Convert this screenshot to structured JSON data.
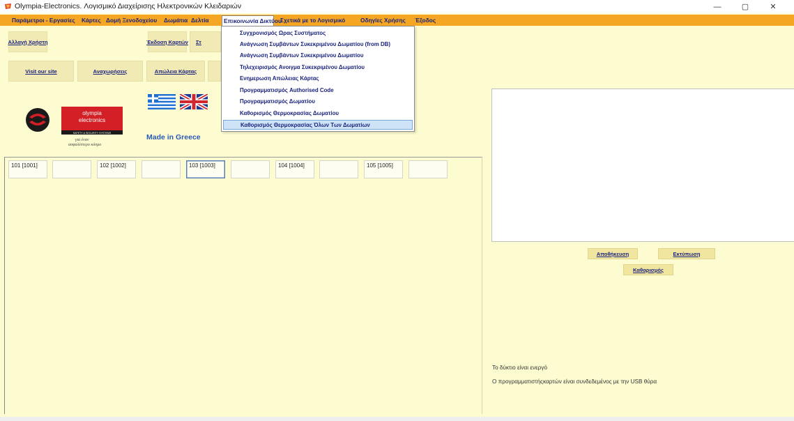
{
  "window": {
    "title": "Olympia-Electronics. Λογισμικό Διαχείρισης Ηλεκτρονικών Κλειδαριών",
    "controls": {
      "minimize": "—",
      "maximize": "▢",
      "close": "✕"
    }
  },
  "menu": [
    "Παράμετροι - Εργασίες",
    "Κάρτες",
    "Δομή Ξενοδοχείου",
    "Δωμάτια",
    "Δελτία",
    "Επικοινωνία Δικτύου",
    "Σχετικά με το Λογισμικό",
    "Οδηγίες Χρήσης",
    "Έξοδος"
  ],
  "toolbar": {
    "row1": [
      "Αλλαγή Χρήστη",
      "Έκδοση Καρτών",
      "Στ"
    ],
    "row2": [
      "Visit our site",
      "Αναχωρήσεις",
      "Απώλεια Κάρτας"
    ]
  },
  "logo": {
    "line1": "olympia",
    "line2": "electronics",
    "line3": "SAFETY & SECURITY SYSTEMS",
    "slogan1": "για έναν",
    "slogan2": "ασφαλέστερο κόσμο"
  },
  "made_in": "Made in Greece",
  "rooms": [
    "101 [1001]",
    "",
    "102 [1002]",
    "",
    "103 [1003]",
    "",
    "104 [1004]",
    "",
    "105 [1005]",
    ""
  ],
  "dropdown": {
    "items": [
      "Συγχρονισμός Ωρας Συστήματος",
      "Ανάγνωση Συμβάντων Συκεκριμένου Δωματίου (from DB)",
      "Ανάγνωση Συμβάντων Συκεκριμένου Δωματίου",
      "Τηλεχειρισμός Ανοιγμα Συκεκριμένου Δωματίου",
      "Ενημερωση Απώλειας Κάρτας",
      "Προγραμματισμός Authorised Code",
      "Προγραμματισμός Δωματίου",
      "Καθορισμός Θερμοκρασίας Δωματίου",
      "Καθορισμός Θερμοκρασίας Όλων Των Δωματίων"
    ]
  },
  "right": {
    "save_label": "Αποθήκευση",
    "print_label": "Εκτύπωση",
    "clear_label": "Καθαρισμός",
    "status1": "Το δύκτιο είναι ενεργό",
    "status2": "Ο προγραμματιστήςκαρτών είναι συνδεδεμένος με την USB θύρα"
  },
  "colors": {
    "menubar": "#f5a623",
    "background": "#fdfbd0",
    "menu_text": "#1a237e",
    "highlight": "#cfe3f7"
  }
}
